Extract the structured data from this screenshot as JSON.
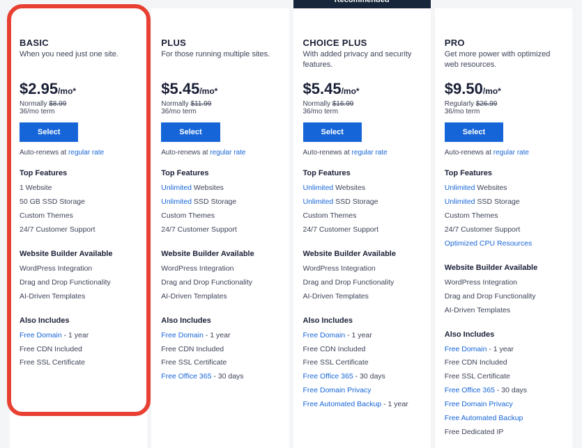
{
  "recommended_label": "Recommended",
  "select_label": "Select",
  "renew_prefix": "Auto-renews at ",
  "renew_link": "regular rate",
  "sections": {
    "top_features": "Top Features",
    "builder": "Website Builder Available",
    "also": "Also Includes"
  },
  "plans": [
    {
      "title": "BASIC",
      "subtitle": "When you need just one site.",
      "price": "$2.95",
      "per": "/mo*",
      "normally_label": "Normally ",
      "normally_price": "$8.99",
      "term": "36/mo term",
      "top_features": [
        {
          "link": "",
          "text": "1 Website"
        },
        {
          "link": "",
          "text": "50 GB SSD Storage"
        },
        {
          "link": "",
          "text": "Custom Themes"
        },
        {
          "link": "",
          "text": "24/7 Customer Support"
        }
      ],
      "builder": [
        {
          "link": "",
          "text": "WordPress Integration"
        },
        {
          "link": "",
          "text": "Drag and Drop Functionality"
        },
        {
          "link": "",
          "text": "AI-Driven Templates"
        }
      ],
      "also": [
        {
          "link": "Free Domain",
          "text": " - 1 year"
        },
        {
          "link": "",
          "text": "Free CDN Included"
        },
        {
          "link": "",
          "text": "Free SSL Certificate"
        }
      ],
      "recommended": false
    },
    {
      "title": "PLUS",
      "subtitle": "For those running multiple sites.",
      "price": "$5.45",
      "per": "/mo*",
      "normally_label": "Normally ",
      "normally_price": "$11.99",
      "term": "36/mo term",
      "top_features": [
        {
          "link": "Unlimited",
          "text": " Websites"
        },
        {
          "link": "Unlimited",
          "text": " SSD Storage"
        },
        {
          "link": "",
          "text": "Custom Themes"
        },
        {
          "link": "",
          "text": "24/7 Customer Support"
        }
      ],
      "builder": [
        {
          "link": "",
          "text": "WordPress Integration"
        },
        {
          "link": "",
          "text": "Drag and Drop Functionality"
        },
        {
          "link": "",
          "text": "AI-Driven Templates"
        }
      ],
      "also": [
        {
          "link": "Free Domain",
          "text": " - 1 year"
        },
        {
          "link": "",
          "text": "Free CDN Included"
        },
        {
          "link": "",
          "text": "Free SSL Certificate"
        },
        {
          "link": "Free Office 365",
          "text": " - 30 days"
        }
      ],
      "recommended": false
    },
    {
      "title": "CHOICE PLUS",
      "subtitle": "With added privacy and security features.",
      "price": "$5.45",
      "per": "/mo*",
      "normally_label": "Normally ",
      "normally_price": "$16.99",
      "term": "36/mo term",
      "top_features": [
        {
          "link": "Unlimited",
          "text": " Websites"
        },
        {
          "link": "Unlimited",
          "text": " SSD Storage"
        },
        {
          "link": "",
          "text": "Custom Themes"
        },
        {
          "link": "",
          "text": "24/7 Customer Support"
        }
      ],
      "builder": [
        {
          "link": "",
          "text": "WordPress Integration"
        },
        {
          "link": "",
          "text": "Drag and Drop Functionality"
        },
        {
          "link": "",
          "text": "AI-Driven Templates"
        }
      ],
      "also": [
        {
          "link": "Free Domain",
          "text": " - 1 year"
        },
        {
          "link": "",
          "text": "Free CDN Included"
        },
        {
          "link": "",
          "text": "Free SSL Certificate"
        },
        {
          "link": "Free Office 365",
          "text": " - 30 days"
        },
        {
          "link": "Free Domain Privacy",
          "text": ""
        },
        {
          "link": "Free Automated Backup",
          "text": " - 1 year"
        }
      ],
      "recommended": true
    },
    {
      "title": "PRO",
      "subtitle": "Get more power with optimized web resources.",
      "price": "$9.50",
      "per": "/mo*",
      "normally_label": "Regularly ",
      "normally_price": "$26.99",
      "term": "36/mo term",
      "top_features": [
        {
          "link": "Unlimited",
          "text": " Websites"
        },
        {
          "link": "Unlimited",
          "text": " SSD Storage"
        },
        {
          "link": "",
          "text": "Custom Themes"
        },
        {
          "link": "",
          "text": "24/7 Customer Support"
        },
        {
          "link": "Optimized CPU Resources",
          "text": ""
        }
      ],
      "builder": [
        {
          "link": "",
          "text": "WordPress Integration"
        },
        {
          "link": "",
          "text": "Drag and Drop Functionality"
        },
        {
          "link": "",
          "text": "AI-Driven Templates"
        }
      ],
      "also": [
        {
          "link": "Free Domain",
          "text": " - 1 year"
        },
        {
          "link": "",
          "text": "Free CDN Included"
        },
        {
          "link": "",
          "text": "Free SSL Certificate"
        },
        {
          "link": "Free Office 365",
          "text": " - 30 days"
        },
        {
          "link": "Free Domain Privacy",
          "text": ""
        },
        {
          "link": "Free Automated Backup",
          "text": ""
        },
        {
          "link": "",
          "text": "Free Dedicated IP"
        }
      ],
      "recommended": false
    }
  ]
}
